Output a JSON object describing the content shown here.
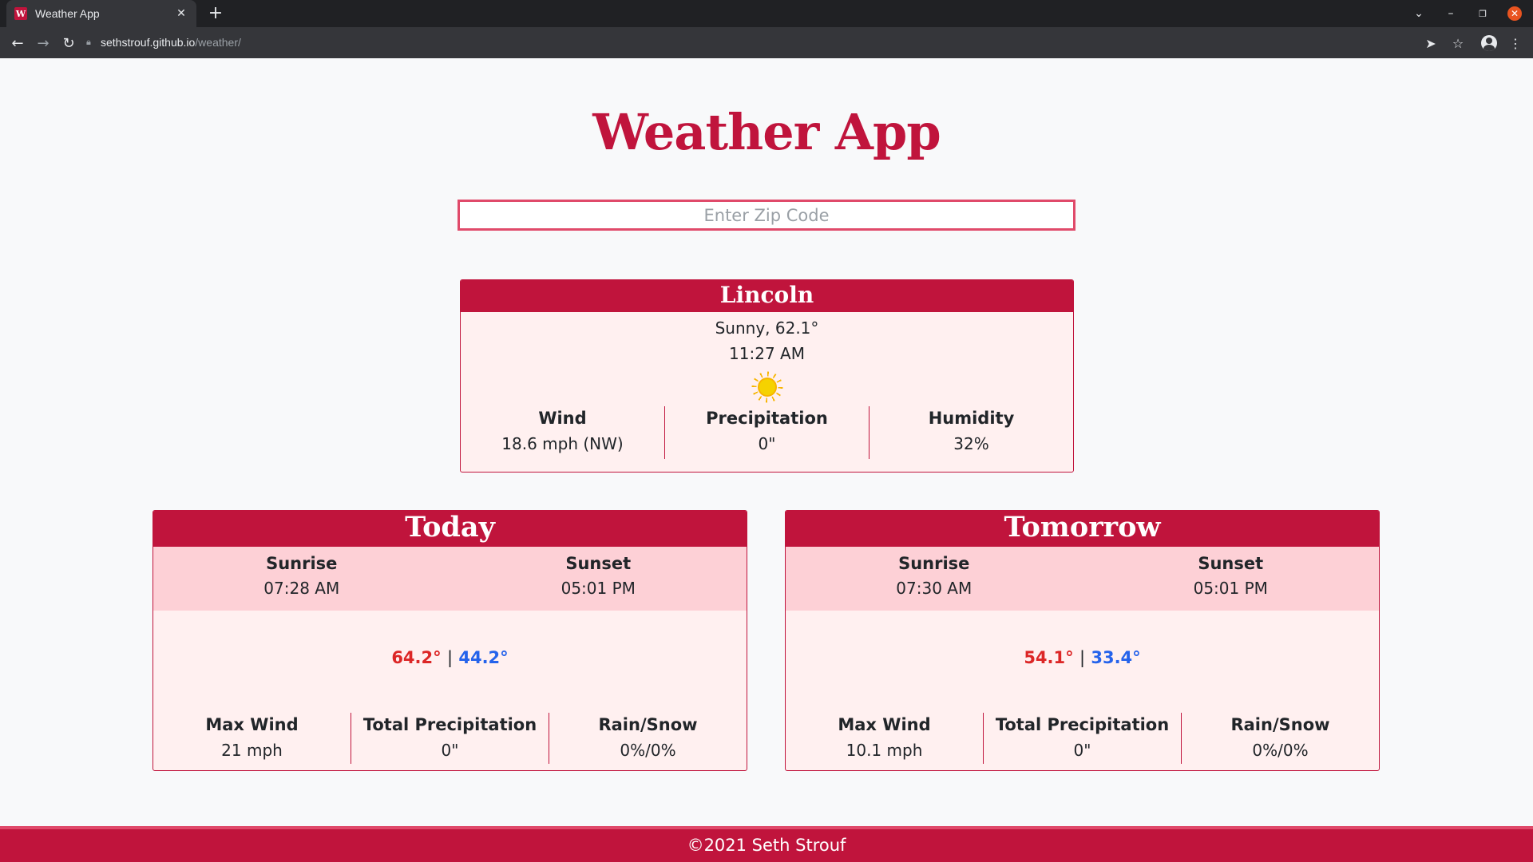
{
  "browser": {
    "tab_title": "Weather App",
    "favicon_letter": "W",
    "url_host": "sethstrouf.github.io",
    "url_path": "/weather/"
  },
  "page": {
    "title": "Weather App",
    "zip_placeholder": "Enter Zip Code"
  },
  "current": {
    "city": "Lincoln",
    "conditions": "Sunny, 62.1°",
    "time": "11:27 AM",
    "icon": "sun-icon",
    "stats": [
      {
        "label": "Wind",
        "value": "18.6 mph (NW)"
      },
      {
        "label": "Precipitation",
        "value": "0\""
      },
      {
        "label": "Humidity",
        "value": "32%"
      }
    ]
  },
  "days": [
    {
      "title": "Today",
      "sunrise_label": "Sunrise",
      "sunrise": "07:28 AM",
      "sunset_label": "Sunset",
      "sunset": "05:01 PM",
      "high": "64.2°",
      "separator": "|",
      "low": "44.2°",
      "stats": [
        {
          "label": "Max Wind",
          "value": "21 mph"
        },
        {
          "label": "Total Precipitation",
          "value": "0\""
        },
        {
          "label": "Rain/Snow",
          "value": "0%/0%"
        }
      ]
    },
    {
      "title": "Tomorrow",
      "sunrise_label": "Sunrise",
      "sunrise": "07:30 AM",
      "sunset_label": "Sunset",
      "sunset": "05:01 PM",
      "high": "54.1°",
      "separator": "|",
      "low": "33.4°",
      "stats": [
        {
          "label": "Max Wind",
          "value": "10.1 mph"
        },
        {
          "label": "Total Precipitation",
          "value": "0\""
        },
        {
          "label": "Rain/Snow",
          "value": "0%/0%"
        }
      ]
    }
  ],
  "footer": {
    "text": "©2021 Seth Strouf"
  },
  "colors": {
    "brand": "#c0143c",
    "card_bg": "#fff0f0",
    "sun_band": "#fdd0d6",
    "high_temp": "#dc2626",
    "low_temp": "#2563eb"
  }
}
